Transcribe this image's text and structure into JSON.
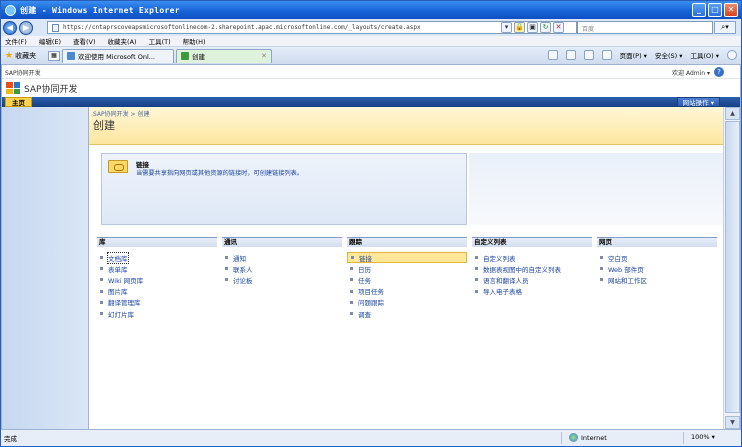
{
  "window": {
    "title": "创建 - Windows Internet Explorer"
  },
  "address": {
    "url": "https://cntaprscoveapsmicrosoftonlinecom-2.sharepoint.apac.microsoftonline.com/_layouts/create.aspx",
    "search_placeholder": "百度"
  },
  "menu": [
    "文件(F)",
    "编辑(E)",
    "查看(V)",
    "收藏夹(A)",
    "工具(T)",
    "帮助(H)"
  ],
  "favorites_label": "收藏夹",
  "tabs": [
    {
      "label": "欢迎使用 Microsoft Onl..."
    },
    {
      "label": "创建"
    }
  ],
  "toolbar_right": {
    "page": "页面(P) ▾",
    "safety": "安全(S) ▾",
    "tools": "工具(O) ▾"
  },
  "site": {
    "breadcrumb_top": "SAP协同开发",
    "welcome": "欢迎 Admin ▾",
    "name": "SAP协同开发",
    "home_tab": "主页",
    "site_actions": "网站操作 ▾",
    "crumb": "SAP协同开发 > 创建",
    "page_title": "创建"
  },
  "description": {
    "title": "链接",
    "text": "当需要共享指向网页或其他资源的链接时，可创建链接列表。"
  },
  "columns": [
    {
      "header": "库",
      "items": [
        "文档库",
        "表单库",
        "Wiki 网页库",
        "图片库",
        "翻译管理库",
        "幻灯片库"
      ]
    },
    {
      "header": "通讯",
      "items": [
        "通知",
        "联系人",
        "讨论板"
      ]
    },
    {
      "header": "跟踪",
      "items": [
        "链接",
        "日历",
        "任务",
        "项目任务",
        "问题跟踪",
        "调查"
      ]
    },
    {
      "header": "自定义列表",
      "items": [
        "自定义列表",
        "数据表视图中的自定义列表",
        "语言和翻译人员",
        "导入电子表格"
      ]
    },
    {
      "header": "网页",
      "items": [
        "空白页",
        "Web 部件页",
        "网站和工作区"
      ]
    }
  ],
  "status": {
    "text": "完成",
    "zone": "Internet",
    "zoom": "100% ▾"
  },
  "colors": {
    "accent_blue": "#1764d8",
    "title_area": "#fde6a0",
    "selected": "#ffe79a"
  }
}
